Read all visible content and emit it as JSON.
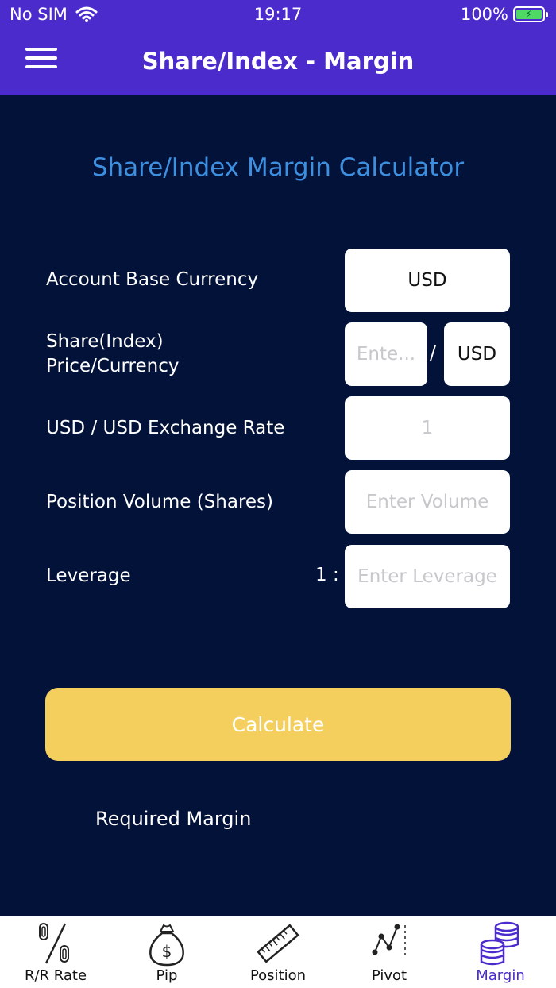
{
  "status": {
    "carrier": "No SIM",
    "time": "19:17",
    "battery": "100%"
  },
  "nav": {
    "title": "Share/Index - Margin"
  },
  "calculator": {
    "title": "Share/Index Margin Calculator",
    "base_currency": {
      "label": "Account Base Currency",
      "value": "USD"
    },
    "price": {
      "label_line1": "Share(Index)",
      "label_line2": "Price/Currency",
      "placeholder": "Ente...",
      "separator": "/",
      "currency": "USD"
    },
    "exchange_rate": {
      "label": "USD / USD Exchange Rate",
      "value": "1"
    },
    "volume": {
      "label": "Position Volume (Shares)",
      "placeholder": "Enter Volume"
    },
    "leverage": {
      "label": "Leverage",
      "ratio": "1 :",
      "placeholder": "Enter Leverage"
    },
    "calculate_label": "Calculate",
    "result_label": "Required Margin"
  },
  "tabs": [
    {
      "label": "R/R Rate",
      "icon": "percent-icon"
    },
    {
      "label": "Pip",
      "icon": "money-bag-icon"
    },
    {
      "label": "Position",
      "icon": "ruler-icon"
    },
    {
      "label": "Pivot",
      "icon": "pivot-chart-icon"
    },
    {
      "label": "Margin",
      "icon": "coin-stack-icon",
      "active": true
    }
  ],
  "colors": {
    "header": "#4b2bcc",
    "background": "#031238",
    "title": "#3d8fe0",
    "button": "#f4cf5e",
    "active_tab": "#4b2bcc"
  }
}
